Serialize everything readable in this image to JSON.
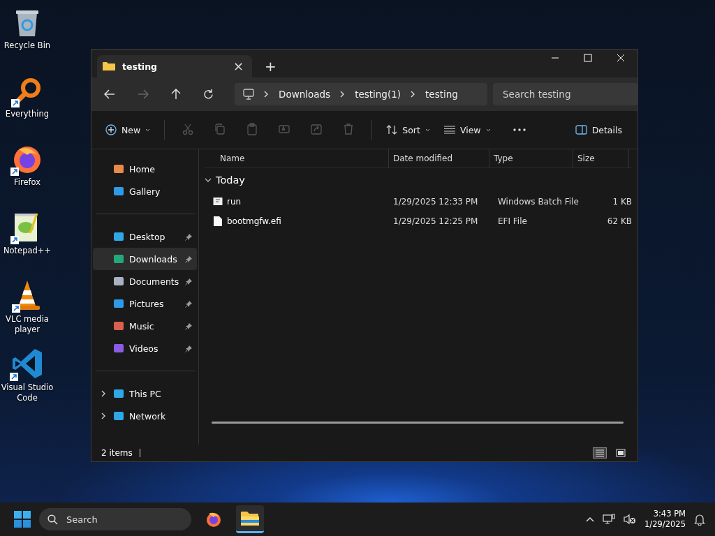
{
  "desktop_icons": [
    {
      "label": "Recycle Bin",
      "shortcut": false
    },
    {
      "label": "Everything",
      "shortcut": true
    },
    {
      "label": "Firefox",
      "shortcut": true
    },
    {
      "label": "Notepad++",
      "shortcut": true
    },
    {
      "label": "VLC media player",
      "shortcut": true
    },
    {
      "label": "Visual Studio Code",
      "shortcut": true
    }
  ],
  "window": {
    "tab": {
      "title": "testing",
      "close": "×"
    },
    "new_tab": "+"
  },
  "address_bar": {
    "breadcrumbs": [
      "Downloads",
      "testing(1)",
      "testing"
    ],
    "search": {
      "placeholder": "Search testing"
    }
  },
  "toolbar": {
    "new": {
      "label": "New"
    },
    "icon_buttons": [
      {
        "disabled": true
      },
      {
        "disabled": true
      },
      {
        "disabled": true
      },
      {
        "disabled": true
      },
      {
        "disabled": true
      },
      {
        "disabled": true
      }
    ],
    "sort": {
      "label": "Sort"
    },
    "view": {
      "label": "View"
    },
    "details": {
      "label": "Details"
    }
  },
  "sidebar": {
    "groups": [
      [
        {
          "label": "Home",
          "selected": false,
          "pinned": false
        },
        {
          "label": "Gallery",
          "selected": false,
          "pinned": false
        }
      ],
      [
        {
          "label": "Desktop",
          "selected": false,
          "pinned": true
        },
        {
          "label": "Downloads",
          "selected": true,
          "pinned": true
        },
        {
          "label": "Documents",
          "selected": false,
          "pinned": true
        },
        {
          "label": "Pictures",
          "selected": false,
          "pinned": true
        },
        {
          "label": "Music",
          "selected": false,
          "pinned": true
        },
        {
          "label": "Videos",
          "selected": false,
          "pinned": true
        }
      ],
      [
        {
          "label": "This PC",
          "selected": false,
          "pinned": false,
          "expanded": false
        },
        {
          "label": "Network",
          "selected": false,
          "pinned": false,
          "expanded": false
        }
      ]
    ]
  },
  "file_list": {
    "columns": [
      "Name",
      "Date modified",
      "Type",
      "Size"
    ],
    "group": {
      "label": "Today",
      "expanded": true
    },
    "rows": [
      {
        "name": "run",
        "date": "1/29/2025 12:33 PM",
        "type": "Windows Batch File",
        "size": "1 KB"
      },
      {
        "name": "bootmgfw.efi",
        "date": "1/29/2025 12:25 PM",
        "type": "EFI File",
        "size": "62 KB"
      }
    ]
  },
  "status_bar": {
    "count": "2 items",
    "views": [
      {
        "selected": true
      },
      {
        "selected": false
      }
    ]
  },
  "taskbar": {
    "search": {
      "placeholder": "Search"
    },
    "apps": [
      {
        "selected": false
      },
      {
        "selected": true
      }
    ],
    "time": "3:43 PM",
    "date": "1/29/2025"
  }
}
